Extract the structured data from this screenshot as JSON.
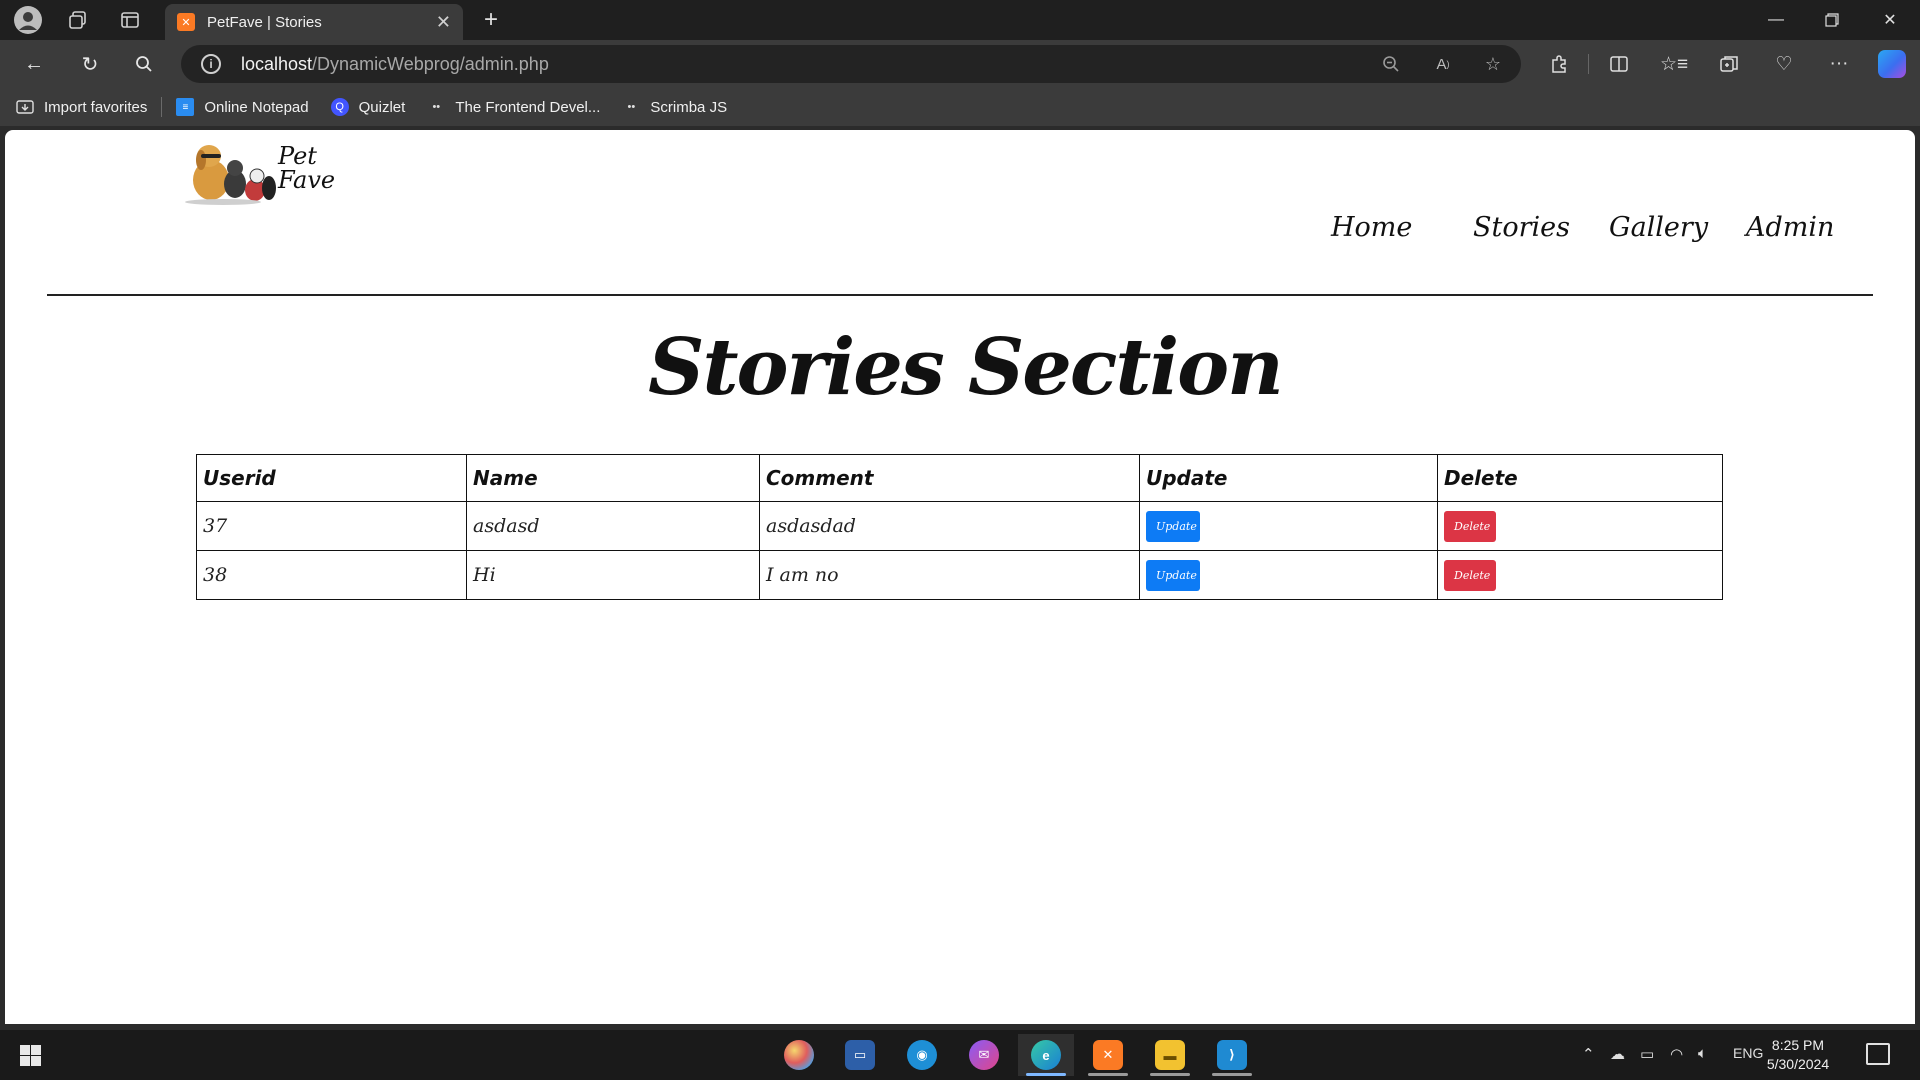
{
  "browser": {
    "tab_title": "PetFave | Stories",
    "tab_favicon": "xampp-icon",
    "url_host": "localhost",
    "url_path": "/DynamicWebprog/admin.php",
    "favorites": [
      {
        "label": "Import favorites",
        "icon": "import-icon"
      },
      {
        "label": "Online Notepad",
        "icon": "notepad-icon"
      },
      {
        "label": "Quizlet",
        "icon": "quizlet-icon"
      },
      {
        "label": "The Frontend Devel...",
        "icon": "scrimba-icon"
      },
      {
        "label": "Scrimba JS",
        "icon": "scrimba-icon"
      }
    ]
  },
  "site": {
    "logo_line1": "Pet",
    "logo_line2": "Fave",
    "nav": [
      "Home",
      "Stories",
      "Gallery",
      "Admin"
    ],
    "heading": "Stories Section"
  },
  "table": {
    "headers": [
      "Userid",
      "Name",
      "Comment",
      "Update",
      "Delete"
    ],
    "rows": [
      {
        "userid": "37",
        "name": "asdasd",
        "comment": "asdasdad",
        "update": "Update",
        "delete": "Delete"
      },
      {
        "userid": "38",
        "name": "Hi",
        "comment": "I am no",
        "update": "Update",
        "delete": "Delete"
      }
    ]
  },
  "colors": {
    "update_button": "#0d7bf5",
    "delete_button": "#dc3545"
  },
  "taskbar": {
    "language": "ENG",
    "time": "8:25 PM",
    "date": "5/30/2024"
  }
}
